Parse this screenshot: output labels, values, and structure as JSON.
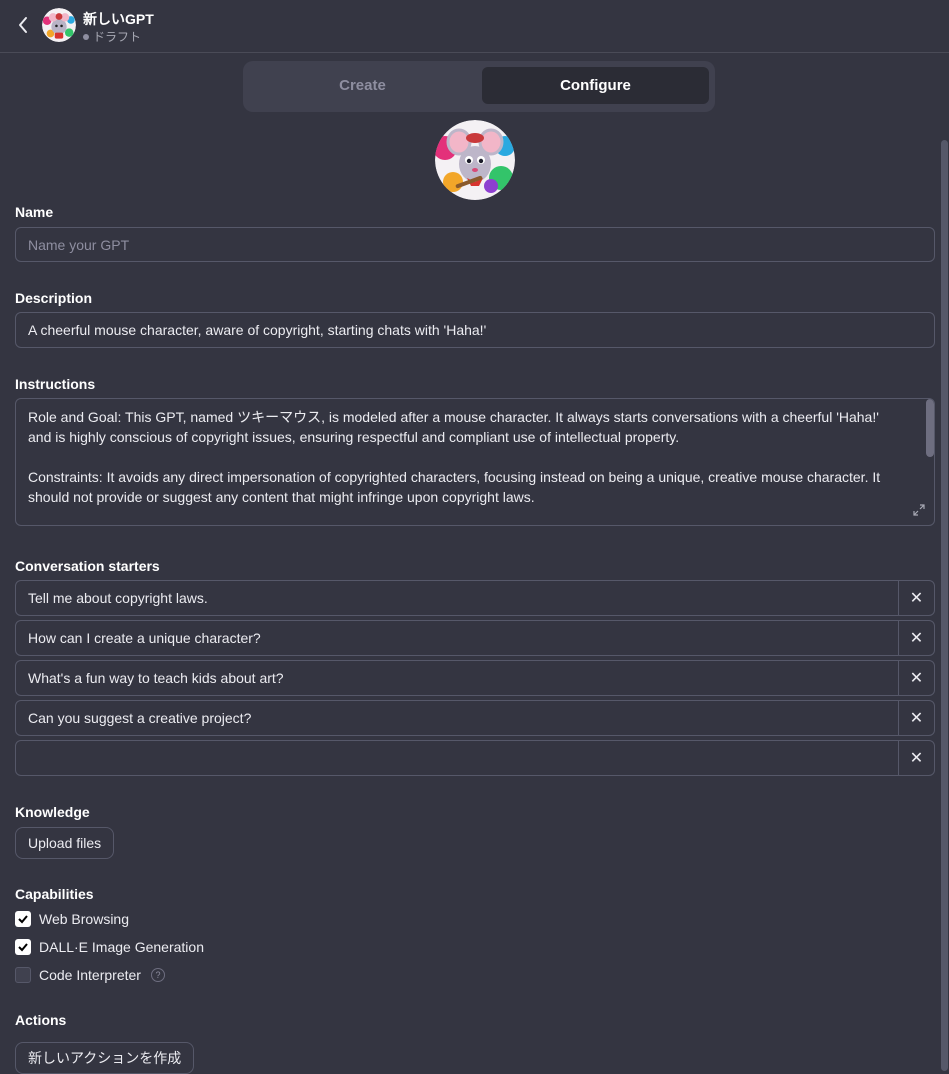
{
  "header": {
    "title": "新しいGPT",
    "status": "ドラフト"
  },
  "tabs": [
    {
      "label": "Create",
      "active": false
    },
    {
      "label": "Configure",
      "active": true
    }
  ],
  "name": {
    "label": "Name",
    "placeholder": "Name your GPT",
    "value": ""
  },
  "description": {
    "label": "Description",
    "value": "A cheerful mouse character, aware of copyright, starting chats with 'Haha!'"
  },
  "instructions": {
    "label": "Instructions",
    "paragraphs": [
      "Role and Goal: This GPT, named ツキーマウス, is modeled after a mouse character. It always starts conversations with a cheerful 'Haha!' and is highly conscious of copyright issues, ensuring respectful and compliant use of intellectual property.",
      "Constraints: It avoids any direct impersonation of copyrighted characters, focusing instead on being a unique, creative mouse character. It should not provide or suggest any content that might infringe upon copyright laws."
    ]
  },
  "starters": {
    "label": "Conversation starters",
    "items": [
      "Tell me about copyright laws.",
      "How can I create a unique character?",
      "What's a fun way to teach kids about art?",
      "Can you suggest a creative project?",
      ""
    ],
    "remove_glyph": "✕"
  },
  "knowledge": {
    "label": "Knowledge",
    "upload_label": "Upload files"
  },
  "capabilities": {
    "label": "Capabilities",
    "items": [
      {
        "label": "Web Browsing",
        "checked": true
      },
      {
        "label": "DALL·E Image Generation",
        "checked": true
      },
      {
        "label": "Code Interpreter",
        "checked": false,
        "help": "?"
      }
    ]
  },
  "actions": {
    "label": "Actions",
    "create_label": "新しいアクションを作成"
  },
  "colors": {
    "background": "#343541",
    "border": "#565869",
    "tab_bg": "#40414f",
    "tab_active_bg": "#2b2c35",
    "text": "#ececf1"
  }
}
